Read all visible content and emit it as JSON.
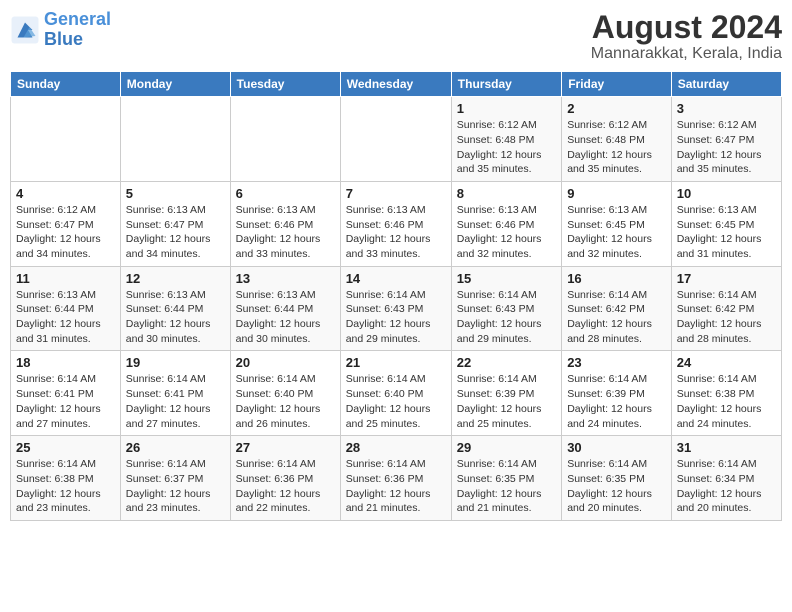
{
  "logo": {
    "line1": "General",
    "line2": "Blue"
  },
  "title": "August 2024",
  "subtitle": "Mannarakkat, Kerala, India",
  "days_of_week": [
    "Sunday",
    "Monday",
    "Tuesday",
    "Wednesday",
    "Thursday",
    "Friday",
    "Saturday"
  ],
  "weeks": [
    [
      {
        "day": "",
        "detail": ""
      },
      {
        "day": "",
        "detail": ""
      },
      {
        "day": "",
        "detail": ""
      },
      {
        "day": "",
        "detail": ""
      },
      {
        "day": "1",
        "detail": "Sunrise: 6:12 AM\nSunset: 6:48 PM\nDaylight: 12 hours\nand 35 minutes."
      },
      {
        "day": "2",
        "detail": "Sunrise: 6:12 AM\nSunset: 6:48 PM\nDaylight: 12 hours\nand 35 minutes."
      },
      {
        "day": "3",
        "detail": "Sunrise: 6:12 AM\nSunset: 6:47 PM\nDaylight: 12 hours\nand 35 minutes."
      }
    ],
    [
      {
        "day": "4",
        "detail": "Sunrise: 6:12 AM\nSunset: 6:47 PM\nDaylight: 12 hours\nand 34 minutes."
      },
      {
        "day": "5",
        "detail": "Sunrise: 6:13 AM\nSunset: 6:47 PM\nDaylight: 12 hours\nand 34 minutes."
      },
      {
        "day": "6",
        "detail": "Sunrise: 6:13 AM\nSunset: 6:46 PM\nDaylight: 12 hours\nand 33 minutes."
      },
      {
        "day": "7",
        "detail": "Sunrise: 6:13 AM\nSunset: 6:46 PM\nDaylight: 12 hours\nand 33 minutes."
      },
      {
        "day": "8",
        "detail": "Sunrise: 6:13 AM\nSunset: 6:46 PM\nDaylight: 12 hours\nand 32 minutes."
      },
      {
        "day": "9",
        "detail": "Sunrise: 6:13 AM\nSunset: 6:45 PM\nDaylight: 12 hours\nand 32 minutes."
      },
      {
        "day": "10",
        "detail": "Sunrise: 6:13 AM\nSunset: 6:45 PM\nDaylight: 12 hours\nand 31 minutes."
      }
    ],
    [
      {
        "day": "11",
        "detail": "Sunrise: 6:13 AM\nSunset: 6:44 PM\nDaylight: 12 hours\nand 31 minutes."
      },
      {
        "day": "12",
        "detail": "Sunrise: 6:13 AM\nSunset: 6:44 PM\nDaylight: 12 hours\nand 30 minutes."
      },
      {
        "day": "13",
        "detail": "Sunrise: 6:13 AM\nSunset: 6:44 PM\nDaylight: 12 hours\nand 30 minutes."
      },
      {
        "day": "14",
        "detail": "Sunrise: 6:14 AM\nSunset: 6:43 PM\nDaylight: 12 hours\nand 29 minutes."
      },
      {
        "day": "15",
        "detail": "Sunrise: 6:14 AM\nSunset: 6:43 PM\nDaylight: 12 hours\nand 29 minutes."
      },
      {
        "day": "16",
        "detail": "Sunrise: 6:14 AM\nSunset: 6:42 PM\nDaylight: 12 hours\nand 28 minutes."
      },
      {
        "day": "17",
        "detail": "Sunrise: 6:14 AM\nSunset: 6:42 PM\nDaylight: 12 hours\nand 28 minutes."
      }
    ],
    [
      {
        "day": "18",
        "detail": "Sunrise: 6:14 AM\nSunset: 6:41 PM\nDaylight: 12 hours\nand 27 minutes."
      },
      {
        "day": "19",
        "detail": "Sunrise: 6:14 AM\nSunset: 6:41 PM\nDaylight: 12 hours\nand 27 minutes."
      },
      {
        "day": "20",
        "detail": "Sunrise: 6:14 AM\nSunset: 6:40 PM\nDaylight: 12 hours\nand 26 minutes."
      },
      {
        "day": "21",
        "detail": "Sunrise: 6:14 AM\nSunset: 6:40 PM\nDaylight: 12 hours\nand 25 minutes."
      },
      {
        "day": "22",
        "detail": "Sunrise: 6:14 AM\nSunset: 6:39 PM\nDaylight: 12 hours\nand 25 minutes."
      },
      {
        "day": "23",
        "detail": "Sunrise: 6:14 AM\nSunset: 6:39 PM\nDaylight: 12 hours\nand 24 minutes."
      },
      {
        "day": "24",
        "detail": "Sunrise: 6:14 AM\nSunset: 6:38 PM\nDaylight: 12 hours\nand 24 minutes."
      }
    ],
    [
      {
        "day": "25",
        "detail": "Sunrise: 6:14 AM\nSunset: 6:38 PM\nDaylight: 12 hours\nand 23 minutes."
      },
      {
        "day": "26",
        "detail": "Sunrise: 6:14 AM\nSunset: 6:37 PM\nDaylight: 12 hours\nand 23 minutes."
      },
      {
        "day": "27",
        "detail": "Sunrise: 6:14 AM\nSunset: 6:36 PM\nDaylight: 12 hours\nand 22 minutes."
      },
      {
        "day": "28",
        "detail": "Sunrise: 6:14 AM\nSunset: 6:36 PM\nDaylight: 12 hours\nand 21 minutes."
      },
      {
        "day": "29",
        "detail": "Sunrise: 6:14 AM\nSunset: 6:35 PM\nDaylight: 12 hours\nand 21 minutes."
      },
      {
        "day": "30",
        "detail": "Sunrise: 6:14 AM\nSunset: 6:35 PM\nDaylight: 12 hours\nand 20 minutes."
      },
      {
        "day": "31",
        "detail": "Sunrise: 6:14 AM\nSunset: 6:34 PM\nDaylight: 12 hours\nand 20 minutes."
      }
    ]
  ]
}
